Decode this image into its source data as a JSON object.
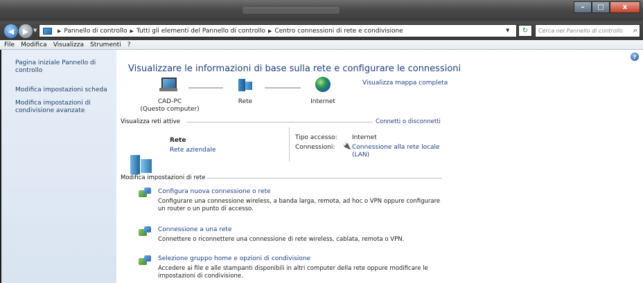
{
  "window": {
    "min_glyph": "–",
    "max_glyph": "□",
    "close_glyph": "x"
  },
  "address": {
    "crumbs": [
      "Pannello di controllo",
      "Tutti gli elementi del Pannello di controllo",
      "Centro connessioni di rete e condivisione"
    ],
    "search_placeholder": "Cerca nel Pannello di controllo"
  },
  "menu": [
    "File",
    "Modifica",
    "Visualizza",
    "Strumenti",
    "?"
  ],
  "sidebar": {
    "items": [
      "Pagina iniziale Pannello di controllo",
      "Modifica impostazioni scheda",
      "Modifica impostazioni di condivisione avanzate"
    ]
  },
  "main": {
    "heading": "Visualizzare le informazioni di base sulla rete e configurare le connessioni",
    "full_map_link": "Visualizza mappa completa",
    "map": {
      "pc_name": "CAD-PC",
      "pc_sub": "(Questo computer)",
      "network": "Rete",
      "internet": "Internet"
    },
    "active": {
      "title": "Visualizza reti attive",
      "connect_link": "Connetti o disconnetti",
      "net_name": "Rete",
      "net_type": "Rete aziendale",
      "access_label": "Tipo accesso:",
      "access_value": "Internet",
      "conn_label": "Connessioni:",
      "conn_value_1": "Connessione alla rete locale",
      "conn_value_2": "(LAN)"
    },
    "settings": {
      "title": "Modifica impostazioni di rete",
      "tasks": [
        {
          "title": "Configura nuova connessione o rete",
          "desc": "Configurare una connessione wireless, a banda larga, remota, ad hoc o VPN oppure configurare un router o un punto di accesso."
        },
        {
          "title": "Connessione a una rete",
          "desc": "Connettere o riconnettere una connessione di rete wireless, cablata, remota o VPN."
        },
        {
          "title": "Selezione gruppo home e opzioni di condivisione",
          "desc": "Accedere ai file e alle stampanti disponibili in altri computer della rete oppure modificare le impostazioni di condivisione."
        }
      ]
    }
  },
  "icons": {
    "help": "?",
    "search": "⌕",
    "refresh": "↻"
  }
}
